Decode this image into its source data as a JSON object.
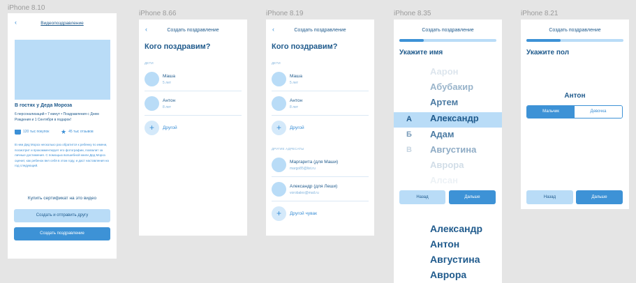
{
  "frames": [
    {
      "label": "iPhone 8.10"
    },
    {
      "label": "iPhone 8.66"
    },
    {
      "label": "iPhone 8.19"
    },
    {
      "label": "iPhone 8.35"
    },
    {
      "label": "iPhone 8.21"
    }
  ],
  "p1": {
    "back": "‹",
    "title": "Видеопоздравление",
    "video_title": "В гостях у Деда Мороза",
    "meta": "6 персонализаций • 7 минут • Поздравления с Днем Рождения и 1 Сентября в подарок!",
    "purchases": "120 тыс покупок",
    "reviews": "45 тыс отзывов",
    "description": "В нем Дед Мороз несколько раз обратится к ребенку по имени, посмотрит и прокомментирует его фотографии, похвалит за личные достижения. С помощью волшебной книги Дед Мороз оценит, как ребенок вел себя в этом году, и даст наставления на год следующий.",
    "certificate": "Купить сертификат на это видео",
    "btn_friend": "Создать и отправить другу",
    "btn_create": "Создать поздравление"
  },
  "p2": {
    "back": "‹",
    "title": "Создать поздравление",
    "question": "Кого поздравим?",
    "section_kids": "ДЕТИ",
    "kids": [
      {
        "name": "Маша",
        "age": "5 лет"
      },
      {
        "name": "Антон",
        "age": "8 лет"
      }
    ],
    "other": "Другой"
  },
  "p3": {
    "back": "‹",
    "title": "Создать поздравление",
    "question": "Кого поздравим?",
    "section_kids": "ДЕТИ",
    "kids": [
      {
        "name": "Маша",
        "age": "5 лет"
      },
      {
        "name": "Антон",
        "age": "8 лет"
      }
    ],
    "other": "Другой",
    "section_others": "ДРУГИЕ АДРЕСАТЫ",
    "adults": [
      {
        "name": "Маргарита (для Маши)",
        "email": "margo85@list.ru"
      },
      {
        "name": "Александр (для Леши)",
        "email": "vorobalex@mail.ru"
      }
    ],
    "other_guy": "Другой чувак"
  },
  "p4": {
    "title": "Создать поздравление",
    "progress": 0.25,
    "prompt": "Укажите имя",
    "names": [
      "Аарон",
      "Абубакир",
      "Артем",
      "Александр",
      "Адам",
      "Августина",
      "Аврора",
      "Алсан"
    ],
    "letters": [
      "А",
      "Б",
      "В"
    ],
    "btn_back": "Назад",
    "btn_next": "Дальше",
    "overflow_names": [
      "Александр",
      "Антон",
      "Августина",
      "Аврора"
    ]
  },
  "p5": {
    "title": "Создать поздравление",
    "progress": 0.35,
    "prompt": "Укажите пол",
    "child": "Антон",
    "boy": "Мальчик",
    "girl": "Девочка",
    "btn_back": "Назад",
    "btn_next": "Дальше"
  }
}
